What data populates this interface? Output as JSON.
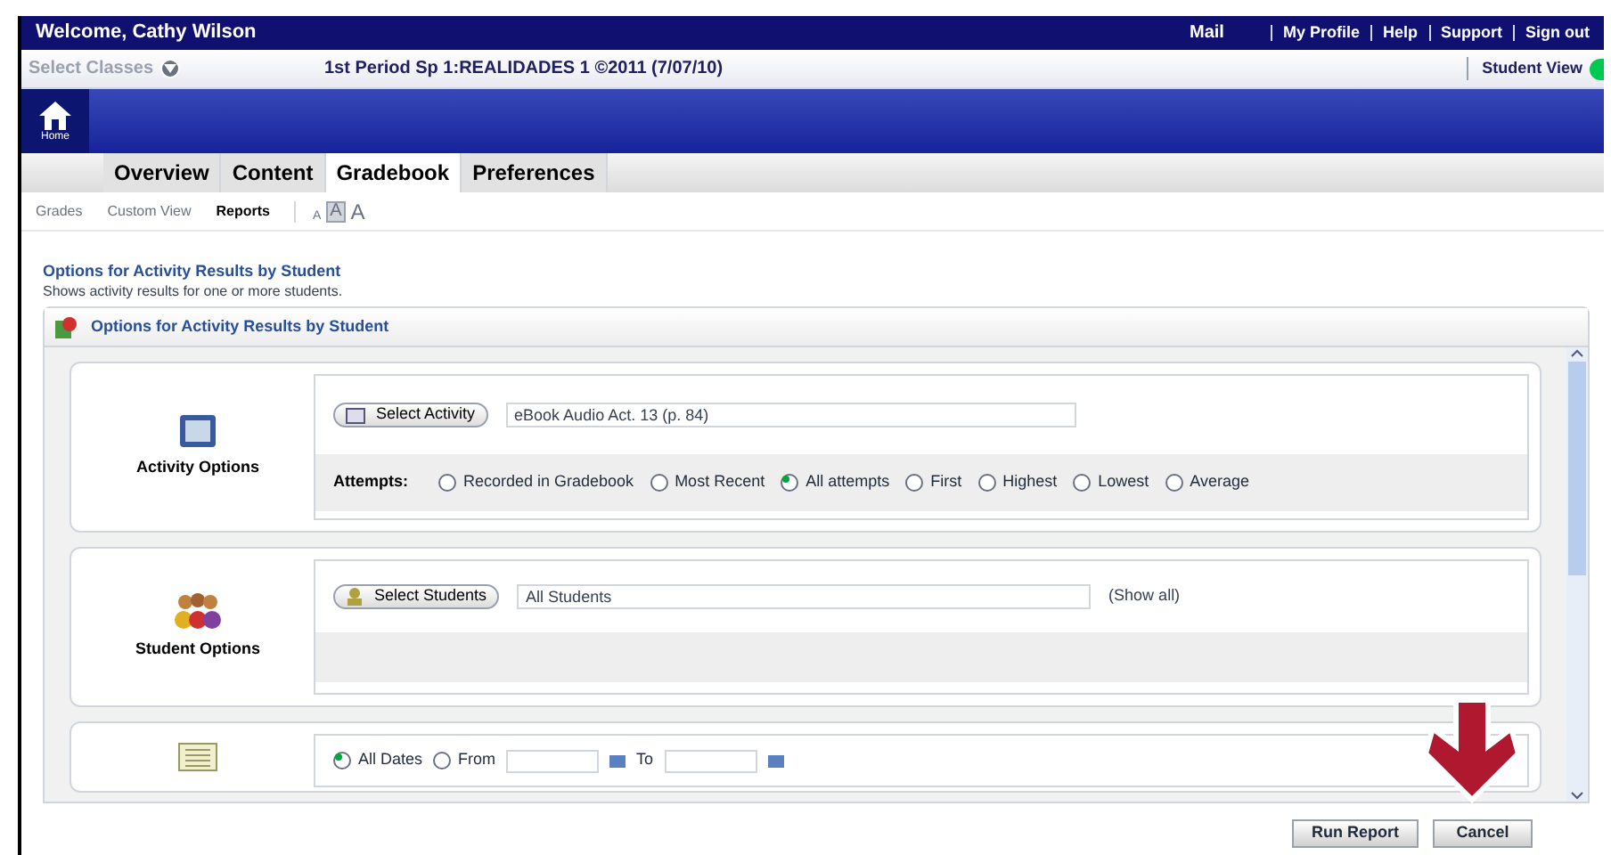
{
  "top_bar": {
    "welcome": "Welcome, Cathy Wilson",
    "links": [
      "Mail",
      "My Profile",
      "Help",
      "Support",
      "Sign out"
    ]
  },
  "class_bar": {
    "select_classes": "Select Classes",
    "class_title": "1st Period Sp 1:REALIDADES 1 ©2011 (7/07/10)",
    "student_view": "Student View"
  },
  "home": {
    "label": "Home"
  },
  "tabs": [
    {
      "label": "Overview",
      "selected": false
    },
    {
      "label": "Content",
      "selected": false
    },
    {
      "label": "Gradebook",
      "selected": true
    },
    {
      "label": "Preferences",
      "selected": false
    }
  ],
  "sub_nav": [
    {
      "label": "Grades",
      "selected": false
    },
    {
      "label": "Custom View",
      "selected": false
    },
    {
      "label": "Reports",
      "selected": true
    }
  ],
  "text_size": [
    {
      "label": "A",
      "selected": false
    },
    {
      "label": "A",
      "selected": true
    },
    {
      "label": "A",
      "selected": false
    }
  ],
  "page": {
    "title": "Options for Activity Results by Student",
    "description": "Shows activity results for one or more students.",
    "panel_title": "Options for Activity Results by Student"
  },
  "sections": [
    {
      "kind": "activity",
      "label": "Activity Options",
      "button": "Select Activity",
      "value": "eBook Audio Act. 13 (p. 84)",
      "attempts_label": "Attempts:",
      "attempts": [
        {
          "label": "Recorded in Gradebook",
          "selected": false
        },
        {
          "label": "Most Recent",
          "selected": false
        },
        {
          "label": "All attempts",
          "selected": true
        },
        {
          "label": "First",
          "selected": false
        },
        {
          "label": "Highest",
          "selected": false
        },
        {
          "label": "Lowest",
          "selected": false
        },
        {
          "label": "Average",
          "selected": false
        }
      ]
    },
    {
      "kind": "students",
      "label": "Student Options",
      "button": "Select Students",
      "value": "All Students",
      "link": "(Show all)"
    },
    {
      "kind": "dates",
      "options": [
        {
          "label": "All Dates",
          "selected": true
        },
        {
          "label": "From",
          "selected": false
        }
      ],
      "to_label": "To"
    }
  ],
  "buttons": [
    "Run Report",
    "Cancel"
  ]
}
